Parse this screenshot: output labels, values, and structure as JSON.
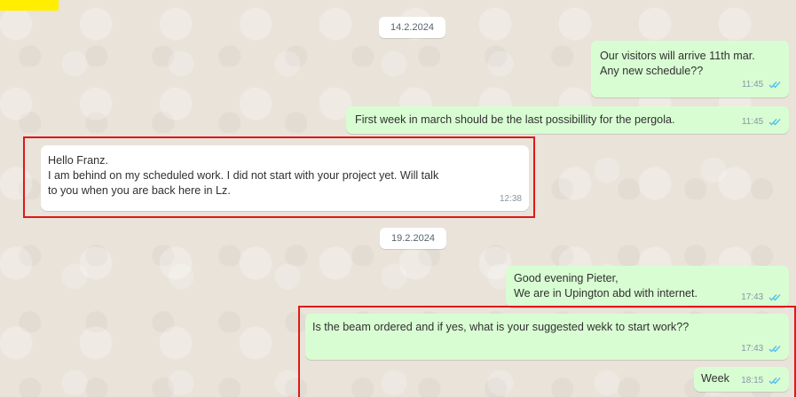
{
  "dates": {
    "first": "14.2.2024",
    "second": "19.2.2024"
  },
  "messages": [
    {
      "direction": "out",
      "text": "Our visitors will arrive 11th mar.\nAny new schedule??",
      "time": "11:45",
      "status_icon": "double-check-read-icon"
    },
    {
      "direction": "out",
      "text": "First week in march should be the last possibillity for the pergola.",
      "time": "11:45",
      "status_icon": "double-check-read-icon"
    },
    {
      "direction": "in",
      "text": "Hello Franz.\nI am behind on my scheduled work. I did not start with your project yet. Will talk\nto you when you are back here in Lz.",
      "time": "12:38"
    },
    {
      "direction": "out",
      "text": "Good evening Pieter,\nWe are in Upington abd with internet.",
      "time": "17:43",
      "status_icon": "double-check-read-icon"
    },
    {
      "direction": "out",
      "text": "Is the beam ordered and if yes, what is your suggested wekk to start work??",
      "time": "17:43",
      "status_icon": "double-check-read-icon"
    },
    {
      "direction": "out",
      "text": "Week",
      "time": "18:15",
      "status_icon": "double-check-read-icon"
    }
  ],
  "colors": {
    "outgoing_bubble": "#d9fdd3",
    "incoming_bubble": "#ffffff",
    "chat_background": "#e9e3da",
    "highlight_border": "#e01818",
    "read_ticks": "#53bdeb",
    "corner_mark": "#ffee00"
  }
}
